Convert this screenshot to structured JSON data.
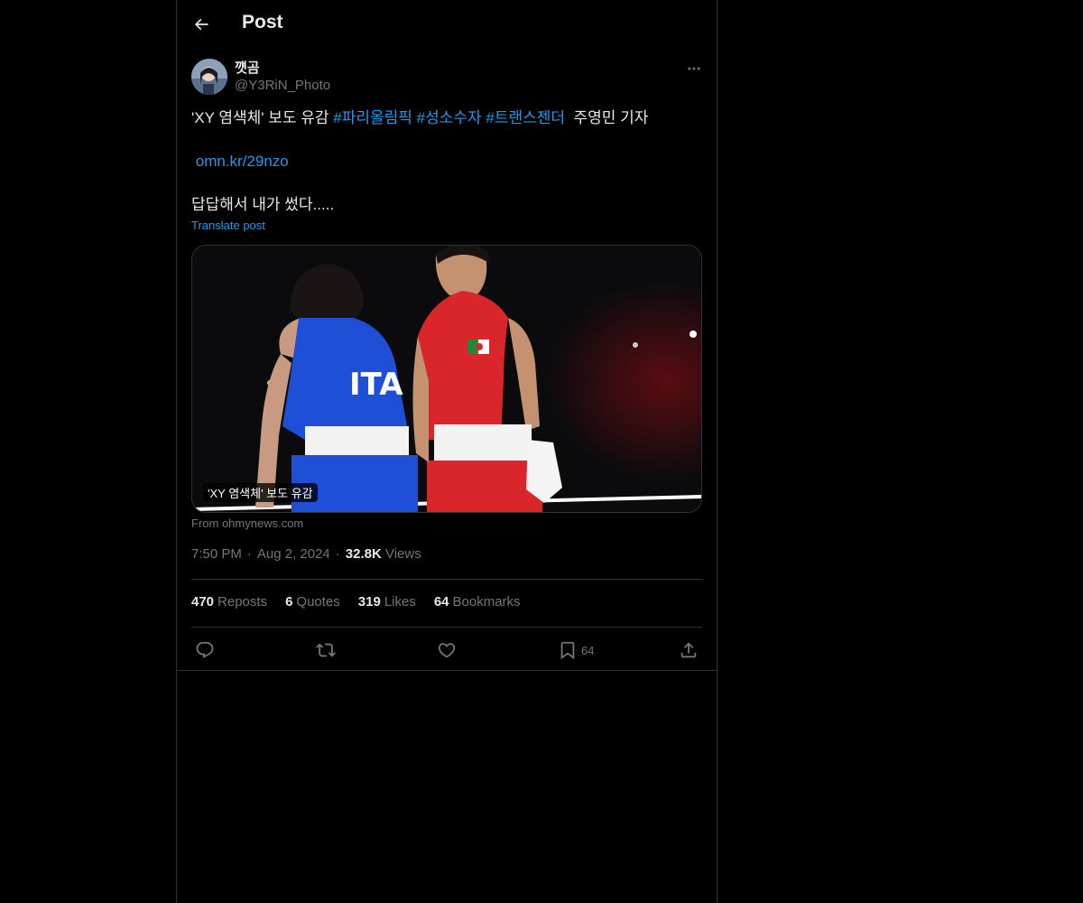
{
  "header": {
    "title": "Post",
    "back_icon": "arrow-left-icon"
  },
  "author": {
    "name": "꺳곰",
    "handle": "@Y3RiN_Photo"
  },
  "tweet": {
    "text_plain": "'XY 염색체' 보도 유감 ",
    "hashtags": [
      "#파리올림픽",
      "#성소수자",
      "#트랜스젠더"
    ],
    "reporter": " 주영민 기자",
    "link": "omn.kr/29nzo",
    "line3": "답답해서 내가 썼다.....",
    "translate_label": "Translate post"
  },
  "card": {
    "caption": "'XY 염색체' 보도 유감",
    "source": "From ohmynews.com",
    "jersey_text": "ITA"
  },
  "meta": {
    "time": "7:50 PM",
    "date": "Aug 2, 2024",
    "views_count": "32.8K",
    "views_label": "Views"
  },
  "stats": {
    "reposts_count": "470",
    "reposts_label": "Reposts",
    "quotes_count": "6",
    "quotes_label": "Quotes",
    "likes_count": "319",
    "likes_label": "Likes",
    "bookmarks_count": "64",
    "bookmarks_label": "Bookmarks"
  },
  "actions": {
    "bookmark_count": "64"
  },
  "colors": {
    "background": "#000000",
    "text": "#e7e9ea",
    "secondary": "#71767b",
    "accent": "#1d9bf0",
    "border": "#2f3336"
  }
}
